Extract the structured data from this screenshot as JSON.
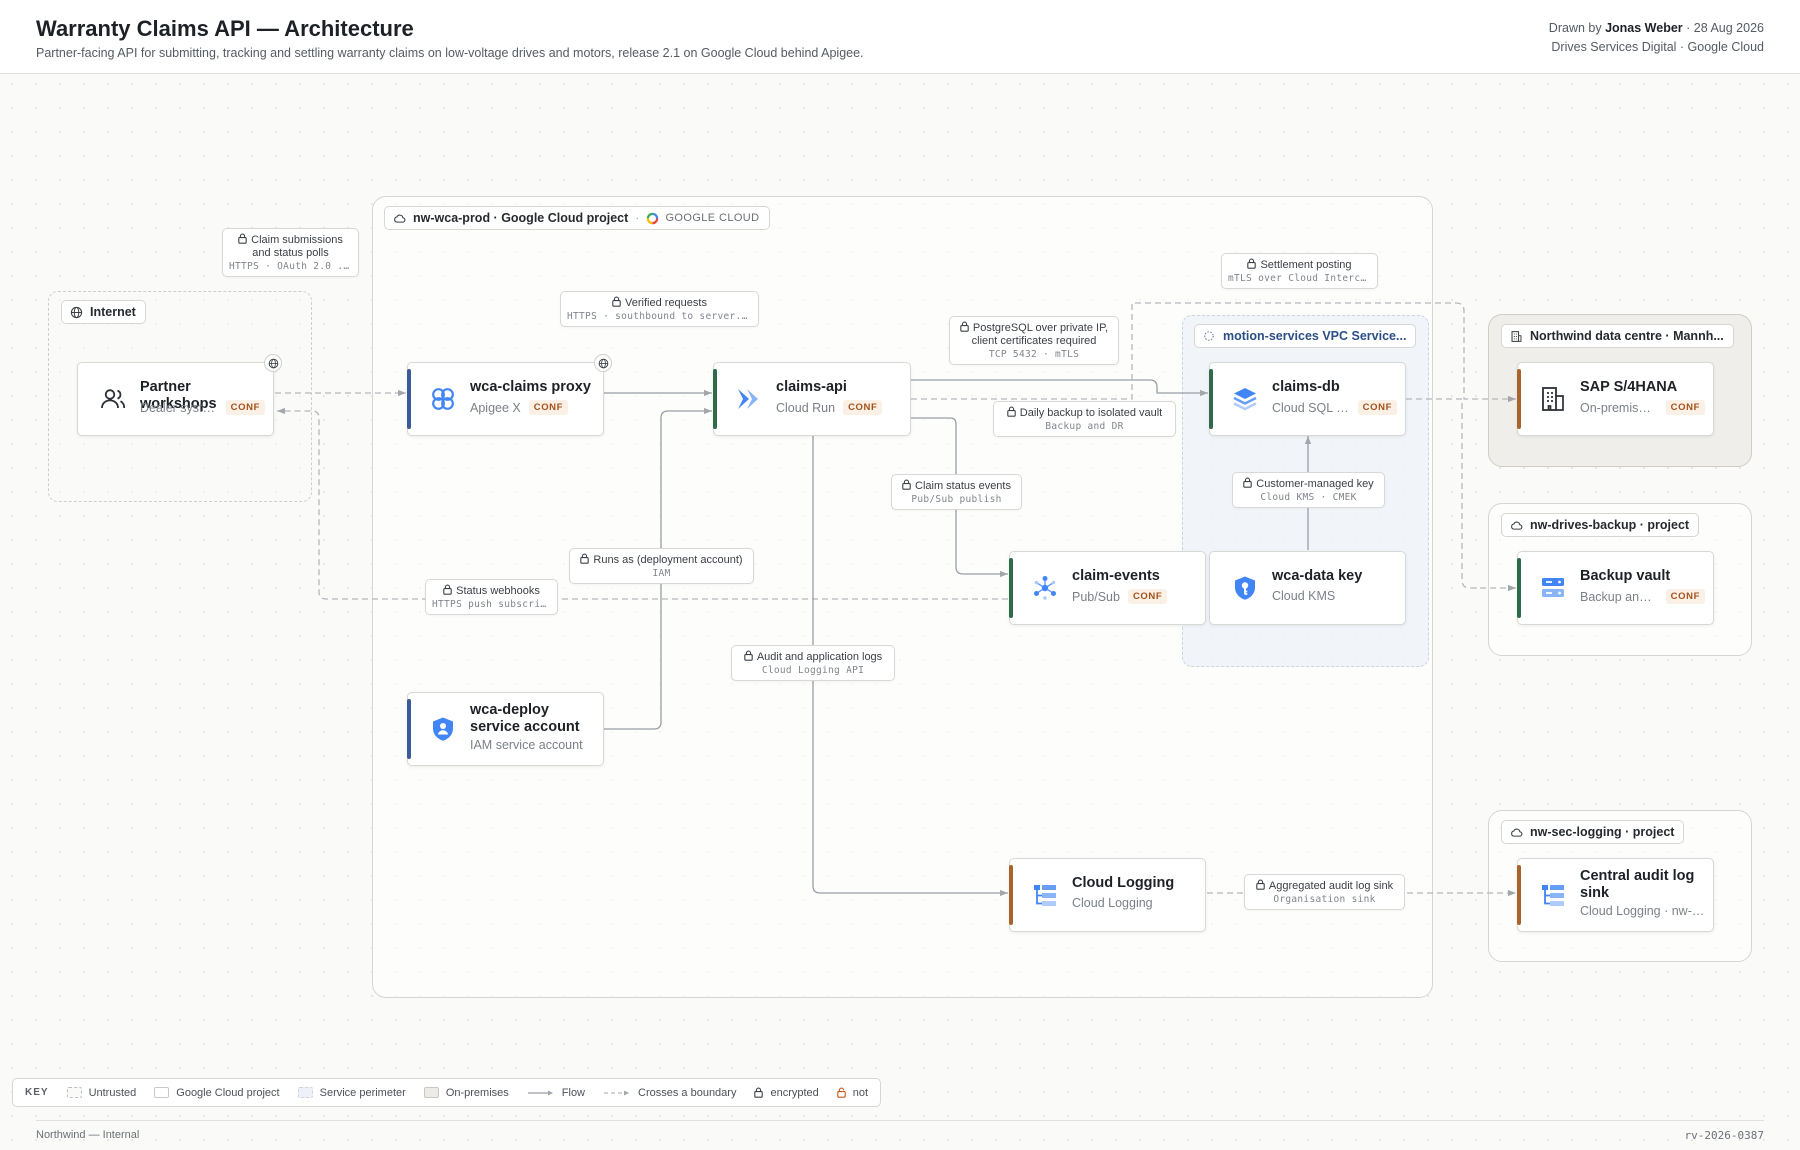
{
  "header": {
    "title": "Warranty Claims API — Architecture",
    "subtitle": "Partner-facing API for submitting, tracking and settling warranty claims on low-voltage drives and motors, release 2.1 on Google Cloud behind Apigee.",
    "drawn_by_prefix": "Drawn by",
    "author": "Jonas Weber",
    "date": "· 28 Aug 2026",
    "org_line": "Drives Services Digital · Google Cloud"
  },
  "zones": {
    "internet": {
      "label": "Internet",
      "icon": "globe-icon"
    },
    "gcp_project": {
      "label": "nw-wca-prod · Google Cloud project",
      "badge": "GOOGLE CLOUD",
      "icon": "cloud-icon"
    },
    "vpc": {
      "label": "motion-services VPC Service...",
      "icon": "perimeter-icon"
    },
    "onprem": {
      "label": "Northwind data centre · Mannh...",
      "icon": "building-icon"
    },
    "backup_project": {
      "label": "nw-drives-backup · project",
      "icon": "cloud-icon"
    },
    "seclog_project": {
      "label": "nw-sec-logging · project",
      "icon": "cloud-icon"
    }
  },
  "nodes": {
    "partner": {
      "title": "Partner workshops",
      "subtitle": "Dealer syste...",
      "badge": "CONF",
      "icon": "people-icon",
      "accent": ""
    },
    "proxy": {
      "title": "wca-claims proxy",
      "subtitle": "Apigee X",
      "badge": "CONF",
      "icon": "apigee-icon",
      "accent": "#3a5a9a"
    },
    "api": {
      "title": "claims-api",
      "subtitle": "Cloud Run",
      "badge": "CONF",
      "icon": "cloud-run-icon",
      "accent": "#2f6a4a"
    },
    "db": {
      "title": "claims-db",
      "subtitle": "Cloud SQL fo...",
      "badge": "CONF",
      "icon": "cloud-sql-icon",
      "accent": "#2f6a4a"
    },
    "sap": {
      "title": "SAP S/4HANA",
      "subtitle": "On-premises...",
      "badge": "CONF",
      "icon": "building-icon",
      "accent": "#a8642a"
    },
    "events": {
      "title": "claim-events",
      "subtitle": "Pub/Sub",
      "badge": "CONF",
      "icon": "pubsub-icon",
      "accent": "#2f6a4a"
    },
    "kms": {
      "title": "wca-data key",
      "subtitle": "Cloud KMS",
      "badge": "",
      "icon": "kms-key-icon",
      "accent": ""
    },
    "vault": {
      "title": "Backup vault",
      "subtitle": "Backup and ...",
      "badge": "CONF",
      "icon": "backup-vault-icon",
      "accent": "#2f6a4a"
    },
    "deploy": {
      "title": "wca-deploy service account",
      "subtitle": "IAM service account",
      "badge": "",
      "icon": "service-account-icon",
      "accent": "#3a5a9a"
    },
    "logging": {
      "title": "Cloud Logging",
      "subtitle": "Cloud Logging",
      "badge": "",
      "icon": "cloud-logging-icon",
      "accent": "#a8642a"
    },
    "sink": {
      "title": "Central audit log sink",
      "subtitle": "Cloud Logging · nw-s...",
      "badge": "",
      "icon": "cloud-logging-icon",
      "accent": "#a8642a"
    }
  },
  "edge_labels": {
    "submissions": {
      "title": "Claim submissions and status polls",
      "protocol": "HTTPS · OAuth 2.0 ..."
    },
    "verified": {
      "title": "Verified requests",
      "protocol": "HTTPS · southbound to server..."
    },
    "postgres": {
      "title": "PostgreSQL over private IP, client certificates required",
      "protocol": "TCP 5432 · mTLS"
    },
    "settlement": {
      "title": "Settlement posting",
      "protocol": "mTLS over Cloud Interc..."
    },
    "backup": {
      "title": "Daily backup to isolated vault",
      "protocol": "Backup and DR"
    },
    "cmek": {
      "title": "Customer-managed key",
      "protocol": "Cloud KMS · CMEK"
    },
    "status_events": {
      "title": "Claim status events",
      "protocol": "Pub/Sub publish"
    },
    "runs_as": {
      "title": "Runs as (deployment account)",
      "protocol": "IAM"
    },
    "webhooks": {
      "title": "Status webhooks",
      "protocol": "HTTPS push subscri..."
    },
    "audit": {
      "title": "Audit and application logs",
      "protocol": "Cloud Logging API"
    },
    "agg_sink": {
      "title": "Aggregated audit log sink",
      "protocol": "Organisation sink"
    }
  },
  "legend": {
    "key": "KEY",
    "items": [
      "Untrusted",
      "Google Cloud project",
      "Service perimeter",
      "On-premises",
      "Flow",
      "Crosses a boundary",
      "encrypted",
      "not"
    ]
  },
  "footer": {
    "left": "Northwind — Internal",
    "right": "rv-2026-0387"
  },
  "colors": {
    "flow": "#9a9ea4",
    "boundary": "#b4b7bb",
    "conf_badge": "#a4521a",
    "lock_encrypted": "#3c4248",
    "lock_not": "#c2571a"
  }
}
